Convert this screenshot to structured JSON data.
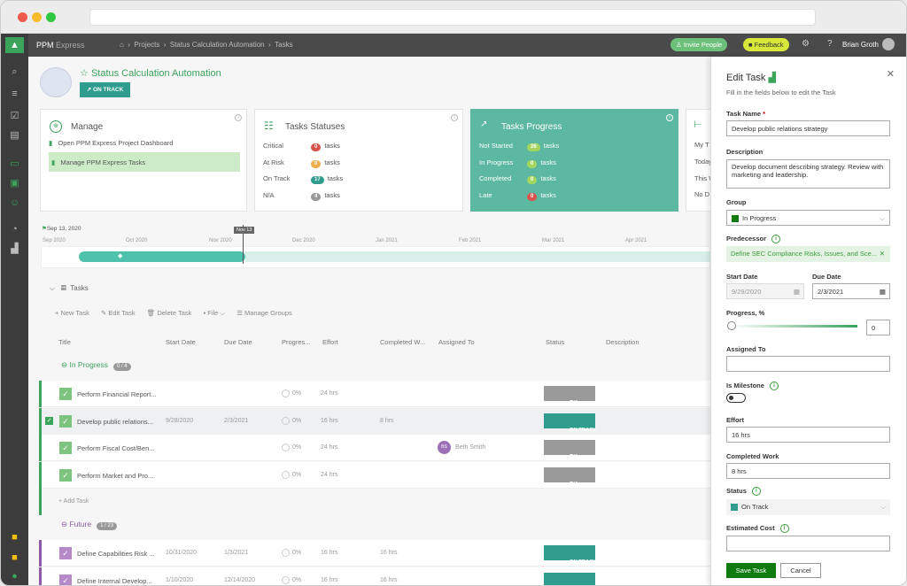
{
  "app": {
    "name": "PPM",
    "name_sub": "Express"
  },
  "breadcrumbs": [
    "Projects",
    "Status Calculation Automation",
    "Tasks"
  ],
  "header": {
    "invite": "Invite People",
    "feedback": "Feedback",
    "user": "Brian Groth"
  },
  "project": {
    "title": "Status Calculation Automation",
    "status": "ON TRACK"
  },
  "manage": {
    "title": "Manage",
    "items": [
      "Open PPM Express Project Dashboard",
      "Manage PPM Express Tasks"
    ]
  },
  "statuses": {
    "title": "Tasks Statuses",
    "rows": [
      {
        "label": "Critical",
        "count": "0",
        "unit": "tasks",
        "color": "#d9534f"
      },
      {
        "label": "At Risk",
        "count": "0",
        "unit": "tasks",
        "color": "#f0ad4e"
      },
      {
        "label": "On Track",
        "count": "17",
        "unit": "tasks",
        "color": "#2f9c8d"
      },
      {
        "label": "N/A",
        "count": "4",
        "unit": "tasks",
        "color": "#999999"
      }
    ]
  },
  "progress": {
    "title": "Tasks Progress",
    "rows": [
      {
        "label": "Not Started",
        "count": "26",
        "unit": "tasks",
        "color": "#a4d65e"
      },
      {
        "label": "In Progress",
        "count": "0",
        "unit": "tasks",
        "color": "#a4d65e"
      },
      {
        "label": "Completed",
        "count": "0",
        "unit": "tasks",
        "color": "#a4d65e"
      },
      {
        "label": "Late",
        "count": "0",
        "unit": "tasks",
        "color": "#d9534f"
      }
    ]
  },
  "mytasks": {
    "rows": [
      "My T",
      "Today",
      "This W",
      "No D"
    ]
  },
  "timeline": {
    "start": "Sep 13, 2020",
    "now": "Nov 13",
    "months": [
      "Sep 2020",
      "Oct 2020",
      "Nov 2020",
      "Dec 2020",
      "Jan 2021",
      "Feb 2021",
      "Mar 2021",
      "Apr 2021"
    ]
  },
  "tasks": {
    "title": "Tasks",
    "toolbar": [
      "New Task",
      "Edit Task",
      "Delete Task",
      "File",
      "Manage Groups"
    ],
    "columns": [
      "Title",
      "Start Date",
      "Due Date",
      "Progres...",
      "Effort",
      "Completed W...",
      "Assigned To",
      "Status",
      "Description"
    ],
    "groups": [
      {
        "name": "In Progress",
        "count": "0 / 4",
        "rows": [
          {
            "title": "Perform Financial Report...",
            "start": "",
            "due": "",
            "progress": "0%",
            "effort": "24 hrs",
            "completed": "",
            "assigned": "",
            "status": "N/A"
          },
          {
            "title": "Develop public relations...",
            "start": "9/28/2020",
            "due": "2/3/2021",
            "progress": "0%",
            "effort": "16 hrs",
            "completed": "8 hrs",
            "assigned": "",
            "status": "ON TRACK"
          },
          {
            "title": "Perform Fiscal Cost/Ben...",
            "start": "",
            "due": "",
            "progress": "0%",
            "effort": "24 hrs",
            "completed": "",
            "assigned": "Beth Smith",
            "status": "N/A"
          },
          {
            "title": "Perform Market and Pro...",
            "start": "",
            "due": "",
            "progress": "0%",
            "effort": "24 hrs",
            "completed": "",
            "assigned": "",
            "status": "N/A"
          }
        ],
        "add": "Add Task"
      },
      {
        "name": "Future",
        "count": "1 / 23",
        "rows": [
          {
            "title": "Define Capabilities Risk ...",
            "start": "10/31/2020",
            "due": "1/3/2021",
            "progress": "0%",
            "effort": "16 hrs",
            "completed": "16 hrs",
            "assigned": "",
            "status": "ON TRACK"
          },
          {
            "title": "Define Internal Develop...",
            "start": "1/10/2020",
            "due": "12/14/2020",
            "progress": "0%",
            "effort": "16 hrs",
            "completed": "16 hrs",
            "assigned": "",
            "status": "ON TRACK"
          }
        ]
      }
    ]
  },
  "edit": {
    "title": "Edit Task",
    "subtitle": "Fill in the fields below to edit the Task",
    "name_label": "Task Name",
    "name": "Develop public relations strategy",
    "desc_label": "Description",
    "desc": "Develop document describing strategy. Review with marketing and leadership.",
    "group_label": "Group",
    "group": "In Progress",
    "pred_label": "Predecessor",
    "pred": "Define SEC Compliance Risks, Issues, and Sce...",
    "start_label": "Start Date",
    "start": "9/29/2020",
    "due_label": "Due Date",
    "due": "2/3/2021",
    "progress_label": "Progress, %",
    "progress": "0",
    "assigned_label": "Assigned To",
    "milestone_label": "Is Milestone",
    "effort_label": "Effort",
    "effort": "16 hrs",
    "completed_label": "Completed Work",
    "completed": "8 hrs",
    "status_label": "Status",
    "status": "On Track",
    "cost_label": "Estimated Cost",
    "save": "Save Task",
    "cancel": "Cancel"
  }
}
